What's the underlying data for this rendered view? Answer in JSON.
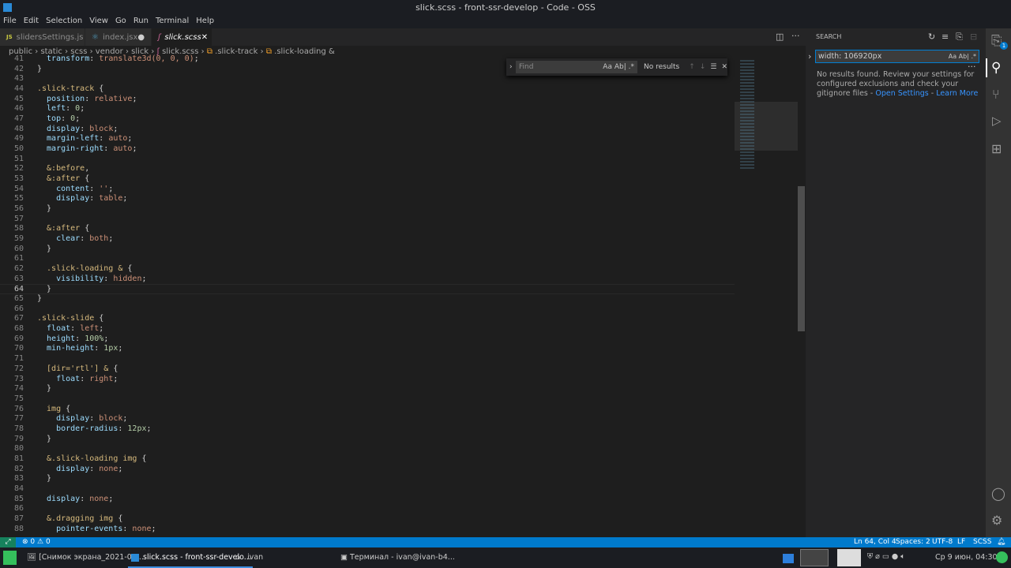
{
  "window": {
    "title": "slick.scss - front-ssr-develop - Code - OSS"
  },
  "menu": [
    "File",
    "Edit",
    "Selection",
    "View",
    "Go",
    "Run",
    "Terminal",
    "Help"
  ],
  "tabs": [
    {
      "label": "slidersSettings.js",
      "icon": "JS"
    },
    {
      "label": "index.jsx",
      "icon": "⚛",
      "modified": true
    },
    {
      "label": "slick.scss",
      "icon": "ʃ",
      "active": true
    }
  ],
  "breadcrumb": [
    "public",
    "static",
    "scss",
    "vendor",
    "slick",
    "slick.scss",
    ".slick-track",
    ".slick-loading &"
  ],
  "find": {
    "placeholder": "Find",
    "result": "No results",
    "aa": "Aa",
    "ab": "Ab|",
    "re": ".*"
  },
  "search": {
    "title": "SEARCH",
    "query": "width: 106920px",
    "message": "No results found. Review your settings for configured exclusions and check your gitignore files - ",
    "open_settings": "Open Settings",
    "sep": " - ",
    "learn_more": "Learn More",
    "badge": "1"
  },
  "code": [
    [
      41,
      [
        [
          "prop",
          "  transform"
        ],
        [
          "pun",
          ": "
        ],
        [
          "val",
          "translate3d(0, 0, 0)"
        ],
        [
          "pun",
          ";"
        ]
      ]
    ],
    [
      42,
      [
        [
          "pun",
          "}"
        ]
      ]
    ],
    [
      43,
      []
    ],
    [
      44,
      [
        [
          "sel",
          ".slick-track"
        ],
        [
          "pun",
          " {"
        ]
      ]
    ],
    [
      45,
      [
        [
          "prop",
          "  position"
        ],
        [
          "pun",
          ": "
        ],
        [
          "val",
          "relative"
        ],
        [
          "pun",
          ";"
        ]
      ]
    ],
    [
      46,
      [
        [
          "prop",
          "  left"
        ],
        [
          "pun",
          ": "
        ],
        [
          "num",
          "0"
        ],
        [
          "pun",
          ";"
        ]
      ]
    ],
    [
      47,
      [
        [
          "prop",
          "  top"
        ],
        [
          "pun",
          ": "
        ],
        [
          "num",
          "0"
        ],
        [
          "pun",
          ";"
        ]
      ]
    ],
    [
      48,
      [
        [
          "prop",
          "  display"
        ],
        [
          "pun",
          ": "
        ],
        [
          "val",
          "block"
        ],
        [
          "pun",
          ";"
        ]
      ]
    ],
    [
      49,
      [
        [
          "prop",
          "  margin-left"
        ],
        [
          "pun",
          ": "
        ],
        [
          "val",
          "auto"
        ],
        [
          "pun",
          ";"
        ]
      ]
    ],
    [
      50,
      [
        [
          "prop",
          "  margin-right"
        ],
        [
          "pun",
          ": "
        ],
        [
          "val",
          "auto"
        ],
        [
          "pun",
          ";"
        ]
      ]
    ],
    [
      51,
      []
    ],
    [
      52,
      [
        [
          "sel",
          "  &:before"
        ],
        [
          "pun",
          ","
        ]
      ]
    ],
    [
      53,
      [
        [
          "sel",
          "  &:after"
        ],
        [
          "pun",
          " {"
        ]
      ]
    ],
    [
      54,
      [
        [
          "prop",
          "    content"
        ],
        [
          "pun",
          ": "
        ],
        [
          "val",
          "''"
        ],
        [
          "pun",
          ";"
        ]
      ]
    ],
    [
      55,
      [
        [
          "prop",
          "    display"
        ],
        [
          "pun",
          ": "
        ],
        [
          "val",
          "table"
        ],
        [
          "pun",
          ";"
        ]
      ]
    ],
    [
      56,
      [
        [
          "pun",
          "  }"
        ]
      ]
    ],
    [
      57,
      []
    ],
    [
      58,
      [
        [
          "sel",
          "  &:after"
        ],
        [
          "pun",
          " {"
        ]
      ]
    ],
    [
      59,
      [
        [
          "prop",
          "    clear"
        ],
        [
          "pun",
          ": "
        ],
        [
          "val",
          "both"
        ],
        [
          "pun",
          ";"
        ]
      ]
    ],
    [
      60,
      [
        [
          "pun",
          "  }"
        ]
      ]
    ],
    [
      61,
      []
    ],
    [
      62,
      [
        [
          "sel",
          "  .slick-loading &"
        ],
        [
          "pun",
          " {"
        ]
      ]
    ],
    [
      63,
      [
        [
          "prop",
          "    visibility"
        ],
        [
          "pun",
          ": "
        ],
        [
          "val",
          "hidden"
        ],
        [
          "pun",
          ";"
        ]
      ]
    ],
    [
      64,
      [
        [
          "pun",
          "  }"
        ]
      ]
    ],
    [
      65,
      [
        [
          "pun",
          "}"
        ]
      ]
    ],
    [
      66,
      []
    ],
    [
      67,
      [
        [
          "sel",
          ".slick-slide"
        ],
        [
          "pun",
          " {"
        ]
      ]
    ],
    [
      68,
      [
        [
          "prop",
          "  float"
        ],
        [
          "pun",
          ": "
        ],
        [
          "val",
          "left"
        ],
        [
          "pun",
          ";"
        ]
      ]
    ],
    [
      69,
      [
        [
          "prop",
          "  height"
        ],
        [
          "pun",
          ": "
        ],
        [
          "num",
          "100%"
        ],
        [
          "pun",
          ";"
        ]
      ]
    ],
    [
      70,
      [
        [
          "prop",
          "  min-height"
        ],
        [
          "pun",
          ": "
        ],
        [
          "num",
          "1px"
        ],
        [
          "pun",
          ";"
        ]
      ]
    ],
    [
      71,
      []
    ],
    [
      72,
      [
        [
          "sel",
          "  [dir='rtl'] &"
        ],
        [
          "pun",
          " {"
        ]
      ]
    ],
    [
      73,
      [
        [
          "prop",
          "    float"
        ],
        [
          "pun",
          ": "
        ],
        [
          "val",
          "right"
        ],
        [
          "pun",
          ";"
        ]
      ]
    ],
    [
      74,
      [
        [
          "pun",
          "  }"
        ]
      ]
    ],
    [
      75,
      []
    ],
    [
      76,
      [
        [
          "sel",
          "  img"
        ],
        [
          "pun",
          " {"
        ]
      ]
    ],
    [
      77,
      [
        [
          "prop",
          "    display"
        ],
        [
          "pun",
          ": "
        ],
        [
          "val",
          "block"
        ],
        [
          "pun",
          ";"
        ]
      ]
    ],
    [
      78,
      [
        [
          "prop",
          "    border-radius"
        ],
        [
          "pun",
          ": "
        ],
        [
          "num",
          "12px"
        ],
        [
          "pun",
          ";"
        ]
      ]
    ],
    [
      79,
      [
        [
          "pun",
          "  }"
        ]
      ]
    ],
    [
      80,
      []
    ],
    [
      81,
      [
        [
          "sel",
          "  &.slick-loading img"
        ],
        [
          "pun",
          " {"
        ]
      ]
    ],
    [
      82,
      [
        [
          "prop",
          "    display"
        ],
        [
          "pun",
          ": "
        ],
        [
          "val",
          "none"
        ],
        [
          "pun",
          ";"
        ]
      ]
    ],
    [
      83,
      [
        [
          "pun",
          "  }"
        ]
      ]
    ],
    [
      84,
      []
    ],
    [
      85,
      [
        [
          "prop",
          "  display"
        ],
        [
          "pun",
          ": "
        ],
        [
          "val",
          "none"
        ],
        [
          "pun",
          ";"
        ]
      ]
    ],
    [
      86,
      []
    ],
    [
      87,
      [
        [
          "sel",
          "  &.dragging img"
        ],
        [
          "pun",
          " {"
        ]
      ]
    ],
    [
      88,
      [
        [
          "prop",
          "    pointer-events"
        ],
        [
          "pun",
          ": "
        ],
        [
          "val",
          "none"
        ],
        [
          "pun",
          ";"
        ]
      ]
    ]
  ],
  "current_line": 64,
  "status": {
    "errors": "0",
    "warnings": "0",
    "position": "Ln 64, Col 4",
    "spaces": "Spaces: 2",
    "encoding": "UTF-8",
    "eol": "LF",
    "language": "SCSS"
  },
  "taskbar": {
    "items": [
      "[Снимок экрана_2021-06...",
      "slick.scss - front-ssr-develo...",
      "ivan",
      "Терминал - ivan@ivan-b4..."
    ],
    "clock": "Ср 9 июн, 04:30"
  },
  "colors": {
    "accent": "#007acc",
    "selector": "#d7ba7d",
    "property": "#9cdcfe",
    "value": "#ce9178",
    "number": "#b5cea8"
  }
}
